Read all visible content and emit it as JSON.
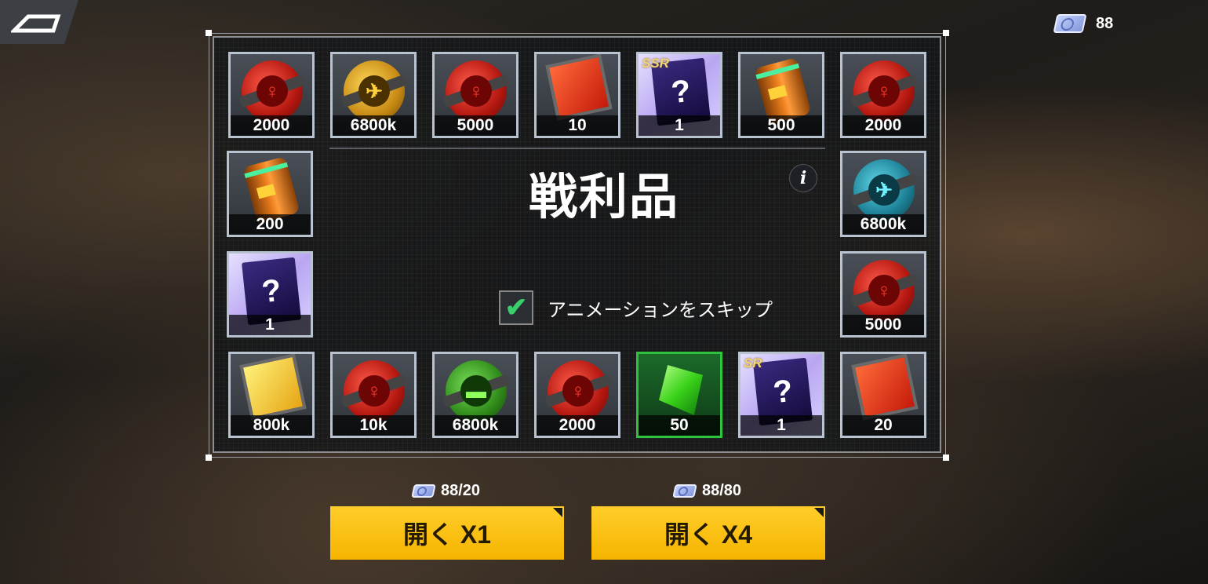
{
  "top_bar": {
    "currency_amount": "88",
    "currency_icon": "ticket-icon",
    "back_icon": "back-arrow-icon"
  },
  "panel": {
    "title": "戦利品",
    "info_label": "i",
    "skip_animation": {
      "label": "アニメーションをスキップ",
      "checked": true
    }
  },
  "rewards": [
    {
      "icon": "red-orb",
      "count": "2000"
    },
    {
      "icon": "gold-orb",
      "count": "6800k"
    },
    {
      "icon": "red-orb",
      "count": "5000"
    },
    {
      "icon": "red-crate",
      "count": "10"
    },
    {
      "icon": "mystery-card",
      "count": "1",
      "tag": "SSR"
    },
    {
      "icon": "orange-barrel",
      "count": "500"
    },
    {
      "icon": "red-orb",
      "count": "2000"
    },
    {
      "icon": "orange-barrel",
      "count": "200"
    },
    {
      "icon": "teal-orb",
      "count": "6800k"
    },
    {
      "icon": "mystery-card",
      "count": "1"
    },
    {
      "icon": "red-orb",
      "count": "5000"
    },
    {
      "icon": "yellow-crate",
      "count": "800k"
    },
    {
      "icon": "red-orb",
      "count": "10k"
    },
    {
      "icon": "green-orb",
      "count": "6800k"
    },
    {
      "icon": "red-orb",
      "count": "2000"
    },
    {
      "icon": "green-gem",
      "count": "50"
    },
    {
      "icon": "mystery-card",
      "count": "1",
      "tag": "SR"
    },
    {
      "icon": "red-crate",
      "count": "20"
    }
  ],
  "actions": [
    {
      "cost": "88/20",
      "label": "開く X1"
    },
    {
      "cost": "88/80",
      "label": "開く X4"
    }
  ],
  "colors": {
    "button": "#f6b400",
    "panel_border": "#8a8e93",
    "check": "#39d06b",
    "gem_border": "#2fc23c"
  }
}
